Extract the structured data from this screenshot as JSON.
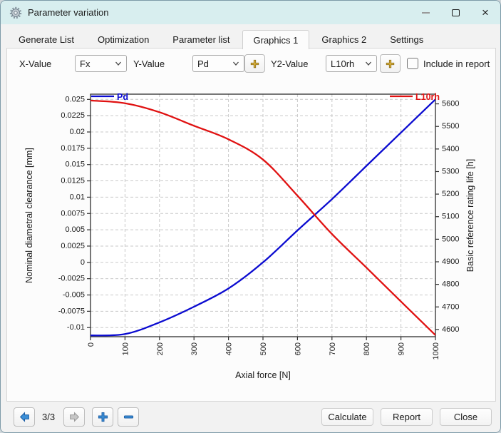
{
  "window": {
    "title": "Parameter variation"
  },
  "tabs": [
    {
      "label": "Generate List",
      "active": false
    },
    {
      "label": "Optimization",
      "active": false
    },
    {
      "label": "Parameter list",
      "active": false
    },
    {
      "label": "Graphics 1",
      "active": true
    },
    {
      "label": "Graphics 2",
      "active": false
    },
    {
      "label": "Settings",
      "active": false
    }
  ],
  "toolbar": {
    "x_value_label": "X-Value",
    "x_value": "Fx",
    "y_value_label": "Y-Value",
    "y_value": "Pd",
    "y2_value_label": "Y2-Value",
    "y2_value": "L10rh",
    "include_in_report_label": "Include in report",
    "include_in_report_checked": false
  },
  "footer": {
    "page_indicator": "3/3",
    "calculate_label": "Calculate",
    "report_label": "Report",
    "close_label": "Close"
  },
  "chart_data": {
    "type": "line",
    "xlabel": "Axial force [N]",
    "ylabel_left": "Nominal diametral clearance [mm]",
    "ylabel_right": "Basic reference rating life [h]",
    "x_range": [
      0,
      1000
    ],
    "x_ticks": [
      0,
      100,
      200,
      300,
      400,
      500,
      600,
      700,
      800,
      900,
      1000
    ],
    "y_left_range": [
      -0.0114,
      0.0258
    ],
    "y_left_ticks": [
      0.025,
      0.0225,
      0.02,
      0.0175,
      0.015,
      0.0125,
      0.01,
      0.0075,
      0.005,
      0.0025,
      0,
      -0.0025,
      -0.005,
      -0.0075,
      -0.01
    ],
    "y_left_tick_labels": [
      "0.025",
      "0.0225",
      "0.02",
      "0.0175",
      "0.015",
      "0.0125",
      "0.01",
      "0.0075",
      "0.005",
      "0.0025",
      "0",
      "-0.0025",
      "-0.005",
      "-0.0075",
      "-0.01"
    ],
    "y_right_range": [
      4568,
      5643
    ],
    "y_right_ticks": [
      5600,
      5500,
      5400,
      5300,
      5200,
      5100,
      5000,
      4900,
      4800,
      4700,
      4600
    ],
    "grid": "dashed",
    "grid_color": "#c9c9c9",
    "axis_color": "#2e2e2e",
    "legend": [
      {
        "name": "Pd",
        "color": "#0b0bd0",
        "position": "top-left"
      },
      {
        "name": "L10rh",
        "color": "#e01111",
        "position": "top-right"
      }
    ],
    "series": [
      {
        "name": "Pd",
        "axis": "left",
        "color": "#0b0bd0",
        "x": [
          0,
          100,
          200,
          300,
          400,
          500,
          600,
          700,
          800,
          900,
          1000
        ],
        "y": [
          -0.0112,
          -0.011,
          -0.0092,
          -0.0068,
          -0.004,
          0.0,
          0.0049,
          0.0097,
          0.0148,
          0.0199,
          0.025
        ]
      },
      {
        "name": "L10rh",
        "axis": "right",
        "color": "#e01111",
        "x": [
          0,
          100,
          200,
          300,
          400,
          500,
          600,
          700,
          800,
          900,
          1000
        ],
        "y": [
          5615,
          5603,
          5563,
          5503,
          5443,
          5353,
          5193,
          5023,
          4874,
          4724,
          4575
        ]
      }
    ]
  }
}
